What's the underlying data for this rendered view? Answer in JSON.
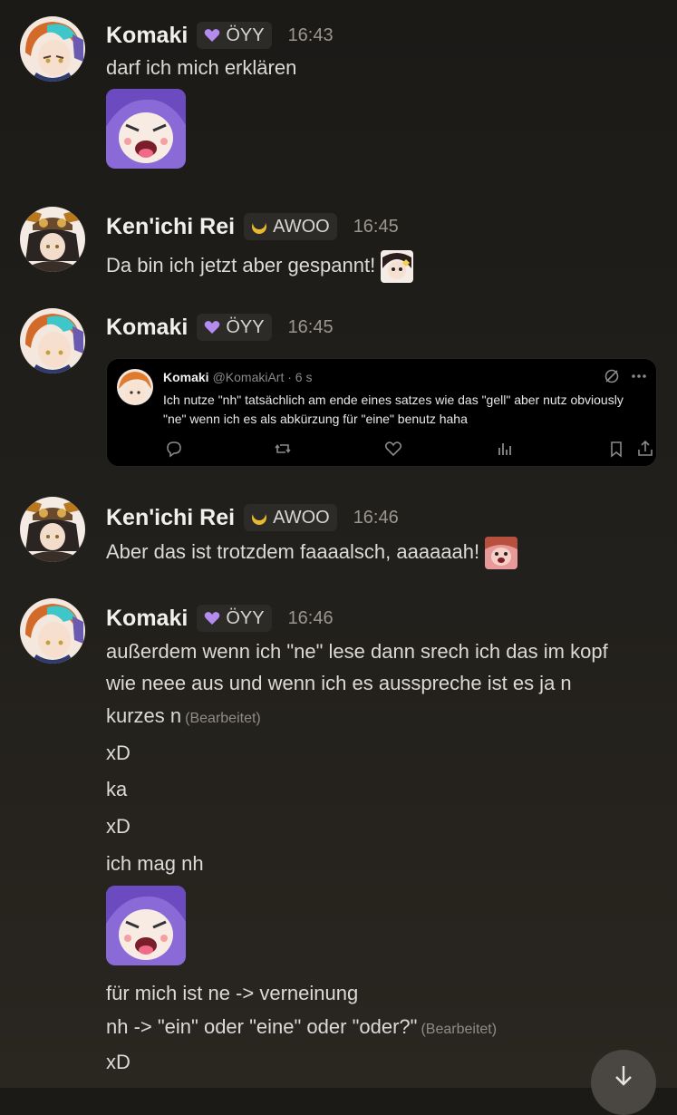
{
  "messages": [
    {
      "author": "Komaki",
      "badge": "ÖYY",
      "time": "16:43",
      "lines": [
        "darf ich mich erklären"
      ]
    },
    {
      "author": "Ken'ichi Rei",
      "badge": "AWOO",
      "time": "16:45",
      "lines": [
        "Da bin ich jetzt aber gespannt!"
      ]
    },
    {
      "author": "Komaki",
      "badge": "ÖYY",
      "time": "16:45",
      "embed": {
        "name": "Komaki",
        "handle": "@KomakiArt · 6 s",
        "body": "Ich nutze \"nh\" tatsächlich am ende eines satzes wie das \"gell\" aber nutz obviously \"ne\" wenn ich es als abkürzung für \"eine\" benutz haha"
      }
    },
    {
      "author": "Ken'ichi Rei",
      "badge": "AWOO",
      "time": "16:46",
      "lines": [
        "Aber das ist trotzdem faaaalsch, aaaaaah!"
      ]
    },
    {
      "author": "Komaki",
      "badge": "ÖYY",
      "time": "16:46",
      "lines": [
        "außerdem wenn ich \"ne\" lese dann srech ich das im kopf",
        "wie neee aus und wenn ich es ausspreche ist es ja n",
        "kurzes n",
        "xD",
        "ka",
        "xD",
        "ich mag nh",
        "für mich ist ne -> verneinung",
        "nh -> \"ein\" oder \"eine\" oder \"oder?\"",
        "xD"
      ],
      "edited": "(Bearbeitet)"
    }
  ],
  "colors": {
    "background": "#1c1a17",
    "badge_bg": "#2d2b28",
    "purple_heart": "#b48cf0",
    "awoo_icon": "#e8b830"
  },
  "icons": [
    "purple-heart-icon",
    "crescent-icon",
    "reply-icon",
    "repost-icon",
    "like-icon",
    "views-icon",
    "bookmark-icon",
    "share-icon",
    "more-icon",
    "grok-icon",
    "arrow-down-icon"
  ]
}
